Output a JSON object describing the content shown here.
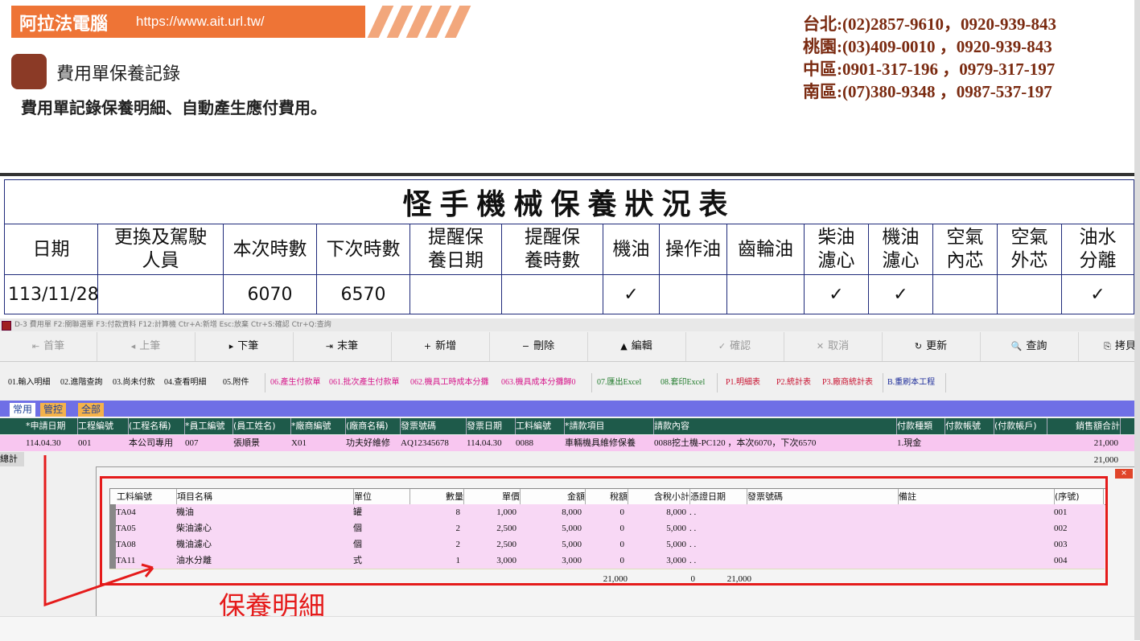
{
  "banner": {
    "brand": "阿拉法電腦",
    "url": "https://www.ait.url.tw/"
  },
  "contacts": [
    "台北:(02)2857-9610，0920-939-843",
    "桃園:(03)409-0010 ，0920-939-843",
    "中區:0901-317-196 ，0979-317-197",
    "南區:(07)380-9348 ，0987-537-197"
  ],
  "page": {
    "title": "費用單保養記錄",
    "subtitle": "費用單記錄保養明細、自動產生應付費用。"
  },
  "maintenance_table": {
    "title": "怪手機械保養狀況表",
    "headers": [
      "日期",
      "更換及駕駛人員",
      "本次時數",
      "下次時數",
      "提醒保養日期",
      "提醒保養時數",
      "機油",
      "操作油",
      "齒輪油",
      "柴油濾心",
      "機油濾心",
      "空氣內芯",
      "空氣外芯",
      "油水分離"
    ],
    "header_lines": [
      [
        "日期"
      ],
      [
        "更換及駕駛",
        "人員"
      ],
      [
        "本次時數"
      ],
      [
        "下次時數"
      ],
      [
        "提醒保",
        "養日期"
      ],
      [
        "提醒保",
        "養時數"
      ],
      [
        "機油"
      ],
      [
        "操作油"
      ],
      [
        "齒輪油"
      ],
      [
        "柴油",
        "濾心"
      ],
      [
        "機油",
        "濾心"
      ],
      [
        "空氣",
        "內芯"
      ],
      [
        "空氣",
        "外芯"
      ],
      [
        "油水",
        "分離"
      ]
    ],
    "row": [
      "113/11/28",
      "",
      "6070",
      "6570",
      "",
      "",
      "✓",
      "",
      "",
      "✓",
      "✓",
      "",
      "",
      "✓"
    ]
  },
  "app": {
    "titlebar": "D-3 費用單 F2:關聯選單 F3:付款資料 F12:計算機 Ctr+A:新增 Esc:放棄 Ctr+S:確認 Ctr+Q:查詢",
    "nav": [
      {
        "icon": "first-icon",
        "glyph": "⇤",
        "label": "首筆",
        "enabled": false
      },
      {
        "icon": "prev-icon",
        "glyph": "◂",
        "label": "上筆",
        "enabled": false
      },
      {
        "icon": "next-icon",
        "glyph": "▸",
        "label": "下筆",
        "enabled": true
      },
      {
        "icon": "last-icon",
        "glyph": "⇥",
        "label": "末筆",
        "enabled": true
      },
      {
        "icon": "add-icon",
        "glyph": "+",
        "label": "新增",
        "enabled": true
      },
      {
        "icon": "delete-icon",
        "glyph": "−",
        "label": "刪除",
        "enabled": true
      },
      {
        "icon": "edit-icon",
        "glyph": "▲",
        "label": "編輯",
        "enabled": true
      },
      {
        "icon": "confirm-icon",
        "glyph": "✓",
        "label": "確認",
        "enabled": false
      },
      {
        "icon": "cancel-icon",
        "glyph": "✕",
        "label": "取消",
        "enabled": false
      },
      {
        "icon": "refresh-icon",
        "glyph": "↻",
        "label": "更新",
        "enabled": true
      },
      {
        "icon": "search-icon",
        "glyph": "🔍",
        "label": "查詢",
        "enabled": true
      },
      {
        "icon": "copy-icon",
        "glyph": "⎘",
        "label": "拷貝",
        "enabled": true
      }
    ],
    "report_buttons": [
      {
        "label": "01.輸入明細",
        "color": "#111111"
      },
      {
        "label": "02.進階查詢",
        "color": "#111111"
      },
      {
        "label": "03.尚未付款",
        "color": "#111111"
      },
      {
        "label": "04.查看明細",
        "color": "#111111"
      },
      {
        "label": "05.附件",
        "color": "#111111"
      },
      {
        "label": "06.產生付款單",
        "color": "#d6168a"
      },
      {
        "label": "061.批次產生付款單",
        "color": "#d6168a"
      },
      {
        "label": "062.機具工時成本分攤",
        "color": "#d6168a"
      },
      {
        "label": "063.機具成本分攤歸0",
        "color": "#d6168a"
      },
      {
        "label": "07.匯出Excel",
        "color": "#1f7a2a"
      },
      {
        "label": "08.套印Excel",
        "color": "#1f7a2a"
      },
      {
        "label": "P1.明細表",
        "color": "#c8102e"
      },
      {
        "label": "P2.統計表",
        "color": "#c8102e"
      },
      {
        "label": "P3.廠商統計表",
        "color": "#c8102e"
      },
      {
        "label": "B.重刷本工程",
        "color": "#1d2d9a"
      }
    ],
    "tabs": [
      "常用",
      "管控",
      "全部"
    ],
    "grid": {
      "headers": [
        "*申請日期",
        "工程編號",
        "(工程名稱)",
        "*員工編號",
        "(員工姓名)",
        "*廠商編號",
        "(廠商名稱)",
        "發票號碼",
        "發票日期",
        "工料編號",
        "*請款項目",
        "請款內容",
        "付款種類",
        "付款帳號",
        "(付款帳戶)",
        "銷售額合計"
      ],
      "row": [
        "114.04.30",
        "001",
        "本公司專用",
        "007",
        "張順景",
        "X01",
        "功夫好維修",
        "AQ12345678",
        "114.04.30",
        "0088",
        "車輛機具維修保養",
        "0088挖土機-PC120 ，本次6070，下次6570",
        "1.現金",
        "",
        "",
        "21,000"
      ],
      "sum_label": "總計",
      "sum_value": "21,000"
    },
    "detail": {
      "headers": [
        "工料編號",
        "項目名稱",
        "單位",
        "數量",
        "單價",
        "金額",
        "稅額",
        "含稅小計",
        "憑證日期",
        "發票號碼",
        "備註",
        "(序號)"
      ],
      "rows": [
        [
          "TA04",
          "機油",
          "罐",
          "8",
          "1,000",
          "8,000",
          "0",
          "8,000",
          ". .",
          "",
          "",
          "001"
        ],
        [
          "TA05",
          "柴油濾心",
          "個",
          "2",
          "2,500",
          "5,000",
          "0",
          "5,000",
          ". .",
          "",
          "",
          "002"
        ],
        [
          "TA08",
          "機油濾心",
          "個",
          "2",
          "2,500",
          "5,000",
          "0",
          "5,000",
          ". .",
          "",
          "",
          "003"
        ],
        [
          "TA11",
          "油水分離",
          "式",
          "1",
          "3,000",
          "3,000",
          "0",
          "3,000",
          ". .",
          "",
          "",
          "004"
        ]
      ],
      "totals": {
        "amount": "21,000",
        "tax": "0",
        "subtotal": "21,000"
      }
    }
  },
  "annotation": {
    "label": "保養明細",
    "color": "#e51b1b"
  },
  "colors": {
    "banner": "#ee7436",
    "contact_text": "#7a2a10",
    "grid_header": "#1e5a4a",
    "row_pink": "#f8c6f0",
    "tab_bar": "#6f6fe6"
  }
}
